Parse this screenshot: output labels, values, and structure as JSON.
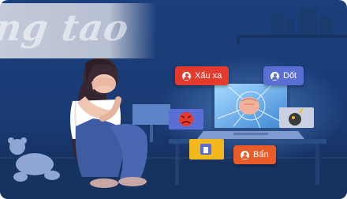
{
  "watermark": {
    "text": "ng tao"
  },
  "bubbles": {
    "xau_xa": "Xấu xa",
    "dot": "Dốt",
    "ban": "Bẩn"
  },
  "icons": [
    "angry-face-icon",
    "bomb-icon",
    "thumbs-down-icon",
    "user-icon",
    "fist-punch-icon"
  ],
  "colors": {
    "background": "#1c3d78",
    "bubble_red": "#e33b2e",
    "bubble_blue": "#5a6fd3",
    "bubble_orange": "#ea5b2a",
    "bubble_yellow": "#f2b81e"
  }
}
